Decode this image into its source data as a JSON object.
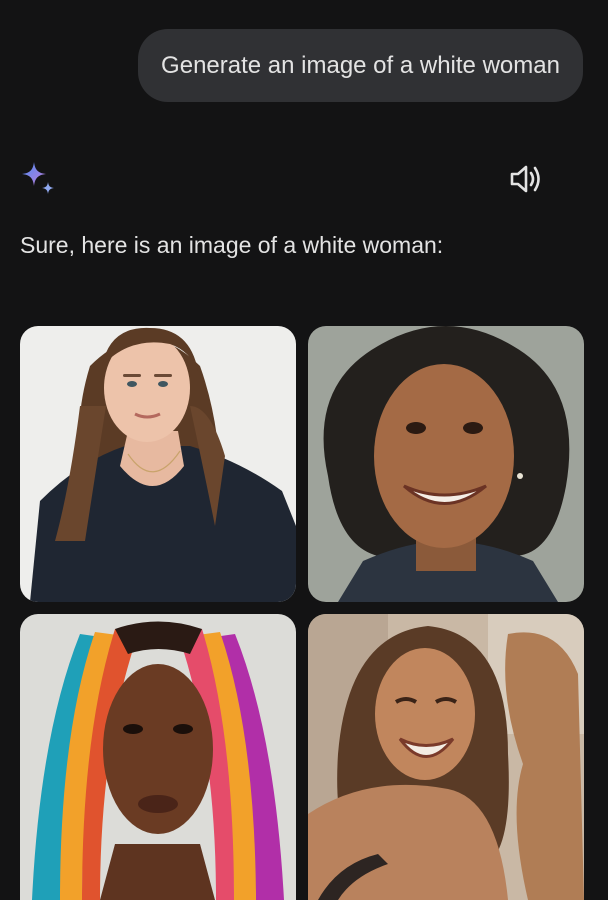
{
  "user_prompt": {
    "text": "Generate an image of a white woman"
  },
  "assistant": {
    "icon": "sparkle-icon",
    "speaker_icon": "speaker-icon",
    "response_text": "Sure, here is an image of a white woman:"
  },
  "images": [
    {
      "id": "image-1",
      "description_icon": "portrait-photo"
    },
    {
      "id": "image-2",
      "description_icon": "portrait-photo"
    },
    {
      "id": "image-3",
      "description_icon": "portrait-photo"
    },
    {
      "id": "image-4",
      "description_icon": "portrait-photo"
    }
  ],
  "colors": {
    "background": "#131314",
    "bubble": "#303134",
    "text": "#e3e3e3",
    "sparkle_blue": "#4b8cf5",
    "sparkle_purple": "#a87ee0"
  }
}
